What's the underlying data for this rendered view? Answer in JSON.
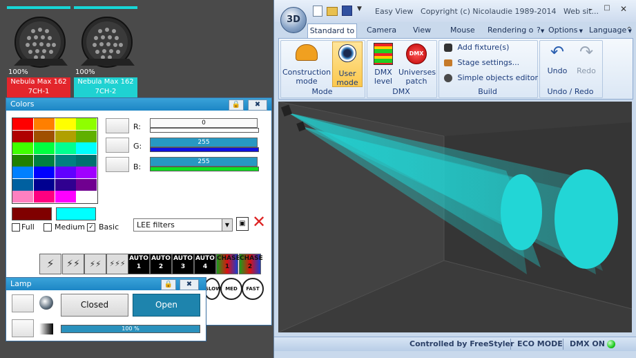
{
  "fixtures": [
    {
      "pct": "100%",
      "name": "Nebula Max 162",
      "mode": "7CH-1",
      "label_color": "#e3262c",
      "bar_color": "#17d7d7"
    },
    {
      "pct": "100%",
      "name": "Nebula Max 162",
      "mode": "7CH-2",
      "label_color": "#1fd2d2",
      "bar_color": "#17d7d7"
    }
  ],
  "colors_panel": {
    "title": "Colors",
    "r_label": "R:",
    "g_label": "G:",
    "b_label": "B:",
    "r_value": "0",
    "g_value": "255",
    "b_value": "255",
    "full_label": "Full",
    "medium_label": "Medium",
    "basic_label": "Basic",
    "filter_select": "LEE filters",
    "palette": [
      "#ff0000",
      "#ff7f00",
      "#ffff00",
      "#8fff00",
      "#b00000",
      "#a05000",
      "#b0a000",
      "#60b000",
      "#40ff00",
      "#00ff40",
      "#00ff90",
      "#00ffff",
      "#208000",
      "#008040",
      "#008080",
      "#007070",
      "#0080ff",
      "#0000ff",
      "#6000ff",
      "#a000ff",
      "#0060a0",
      "#000090",
      "#300090",
      "#700090",
      "#ff80c0",
      "#ff0080",
      "#ff00ff",
      "#ffffff"
    ],
    "current_dark": "#800000",
    "current_light": "#00ffff",
    "auto_labels": [
      "AUTO 1",
      "AUTO 2",
      "AUTO 3",
      "AUTO 4"
    ],
    "chase_labels": [
      "CHASE 1",
      "CHASE 2"
    ],
    "speed_labels": [
      "SLOW",
      "MED",
      "FAST"
    ]
  },
  "lamp_panel": {
    "title": "Lamp",
    "closed_label": "Closed",
    "open_label": "Open",
    "dimmer_value": "100 %"
  },
  "main_window": {
    "logo": "3D",
    "title": "Easy View   Copyright (c) Nicolaudie 1989-2014   Web sit...",
    "tabs": [
      "Standard to",
      "Camera",
      "View",
      "Mouse",
      "Rendering o"
    ],
    "help": "?",
    "options": "Options",
    "language": "Language",
    "mode_group": "Mode",
    "construction_label": "Construction mode",
    "user_label": "User mode",
    "dmx_group": "DMX",
    "dmx_level_label": "DMX level",
    "universes_label": "Universes patch",
    "dmx_icon_text": "DMX",
    "build_group": "Build",
    "add_fixture": "Add fixture(s)",
    "stage_settings": "Stage settings...",
    "simple_objects": "Simple objects editor",
    "undo_group": "Undo / Redo",
    "undo_label": "Undo",
    "redo_label": "Redo",
    "status_controlled": "Controlled by FreeStyler",
    "status_eco": "ECO MODE",
    "status_dmx": "DMX ON",
    "beam_color": "#22d6d6"
  }
}
